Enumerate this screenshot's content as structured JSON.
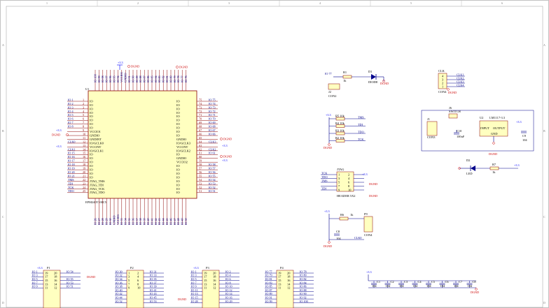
{
  "frame": {
    "columns": [
      "1",
      "2",
      "3",
      "4",
      "5",
      "6"
    ],
    "rows": [
      "A",
      "B",
      "C",
      "D"
    ]
  },
  "power": {
    "v33": "+3.3",
    "dgnd": "DGND"
  },
  "mcu": {
    "ref": "U1",
    "part": "EPM240T100C5",
    "left_pins": [
      {
        "net": "IO 1",
        "name": "IO",
        "num": "1"
      },
      {
        "net": "IO 2",
        "name": "IO",
        "num": "2"
      },
      {
        "net": "IO 3",
        "name": "IO",
        "num": "3"
      },
      {
        "net": "IO 4",
        "name": "IO",
        "num": "4"
      },
      {
        "net": "IO 5",
        "name": "IO",
        "num": "5"
      },
      {
        "net": "IO 6",
        "name": "IO",
        "num": "6"
      },
      {
        "net": "IO 7",
        "name": "IO",
        "num": "7"
      },
      {
        "net": "IO 8",
        "name": "IO",
        "num": "8"
      },
      {
        "net": "",
        "name": "VCCIO1",
        "num": "9"
      },
      {
        "net": "",
        "name": "GNDIO",
        "num": "10"
      },
      {
        "net": "",
        "name": "GNDINT",
        "num": "11"
      },
      {
        "net": "CLK0",
        "name": "IO/GCLK0",
        "num": "12"
      },
      {
        "net": "",
        "name": "VCCINT",
        "num": "13"
      },
      {
        "net": "CLK1",
        "name": "IO/GCLK1",
        "num": "14"
      },
      {
        "net": "IO 15",
        "name": "IO",
        "num": "15"
      },
      {
        "net": "IO 16",
        "name": "IO",
        "num": "16"
      },
      {
        "net": "IO 17",
        "name": "IO",
        "num": "17"
      },
      {
        "net": "IO 18",
        "name": "IO",
        "num": "18"
      },
      {
        "net": "IO 19",
        "name": "IO",
        "num": "19"
      },
      {
        "net": "IO 20",
        "name": "IO",
        "num": "20"
      },
      {
        "net": "IO 21",
        "name": "IO",
        "num": "21"
      },
      {
        "net": "TMS",
        "name": "JTAG_TMS",
        "num": "22"
      },
      {
        "net": "TDI",
        "name": "JTAG_TDI",
        "num": "23"
      },
      {
        "net": "TCK",
        "name": "JTAG_TCK",
        "num": "24"
      },
      {
        "net": "TDO",
        "name": "JTAG_TDO",
        "num": "25"
      }
    ],
    "right_pins": [
      {
        "net": "IO 75",
        "name": "IO",
        "num": "75"
      },
      {
        "net": "IO 74",
        "name": "IO",
        "num": "74"
      },
      {
        "net": "IO 73",
        "name": "IO",
        "num": "73"
      },
      {
        "net": "IO 72",
        "name": "IO",
        "num": "72"
      },
      {
        "net": "IO 71",
        "name": "IO",
        "num": "71"
      },
      {
        "net": "IO 70",
        "name": "IO",
        "num": "70"
      },
      {
        "net": "IO 69",
        "name": "IO",
        "num": "69"
      },
      {
        "net": "IO 68",
        "name": "IO",
        "num": "68"
      },
      {
        "net": "IO 67",
        "name": "IO",
        "num": "67"
      },
      {
        "net": "IO 66",
        "name": "IO",
        "num": "66"
      },
      {
        "net": "",
        "name": "GNDIO",
        "num": "65"
      },
      {
        "net": "CLK3",
        "name": "IO/GCLK3",
        "num": "64"
      },
      {
        "net": "",
        "name": "VCCINT",
        "num": "63"
      },
      {
        "net": "CLK2",
        "name": "IO/GCLK2",
        "num": "62"
      },
      {
        "net": "IO 61",
        "name": "IO",
        "num": "61"
      },
      {
        "net": "",
        "name": "GNDIO",
        "num": "60"
      },
      {
        "net": "",
        "name": "VCCIO2",
        "num": "59"
      },
      {
        "net": "IO 58",
        "name": "IO",
        "num": "58"
      },
      {
        "net": "IO 57",
        "name": "IO",
        "num": "57"
      },
      {
        "net": "IO 56",
        "name": "IO",
        "num": "56"
      },
      {
        "net": "IO 55",
        "name": "IO",
        "num": "55"
      },
      {
        "net": "IO 54",
        "name": "IO",
        "num": "54"
      },
      {
        "net": "IO 53",
        "name": "IO",
        "num": "53"
      },
      {
        "net": "IO 52",
        "name": "IO",
        "num": "52"
      },
      {
        "net": "IO 51",
        "name": "IO",
        "num": "51"
      }
    ],
    "top_pins": [
      "IO 100",
      "IO 99",
      "IO 98",
      "IO 97",
      "IO 96",
      "IO 95",
      "IO 94",
      "VCCIO1",
      "GNDIO",
      "IO 91",
      "IO 90",
      "IO 89",
      "IO 88",
      "IO 87",
      "IO 86",
      "IO 85",
      "IO 84",
      "IO 83",
      "IO 82",
      "IO 81",
      "IO 80",
      "IO 79",
      "IO 78",
      "IO 77",
      "IO 76"
    ],
    "bottom_pins": [
      "IO 26",
      "IO 27",
      "IO 28",
      "IO 29",
      "IO 30",
      "GNDIO",
      "VCCIO1",
      "IO 33",
      "IO 34",
      "IO 35",
      "IO 36",
      "IO 37",
      "IO 38",
      "IO 39",
      "IO 40",
      "IO 41",
      "IO 42",
      "IO 43",
      "IO 44",
      "IO 45",
      "IO 46",
      "IO 47",
      "IO 48",
      "IO 49",
      "IO 50"
    ]
  },
  "led_circuit": {
    "net": "IO 77",
    "r_ref": "R1",
    "r_val": "1k",
    "d_ref": "D1",
    "d_val": "DIODE",
    "j_ref": "J2",
    "j_val": "CON2"
  },
  "clock": {
    "ref": "CLK",
    "part": "CON4",
    "pins": [
      "4",
      "3",
      "2",
      "1"
    ],
    "nets": [
      "CLK1",
      "CLK2",
      "CLK3",
      "CLK4"
    ]
  },
  "pullups": {
    "resistors": [
      "R5 10k",
      "R4 10k",
      "R3 10k",
      "R2 10k"
    ],
    "nets": [
      "TMS",
      "TDI",
      "TDO",
      "TCK"
    ]
  },
  "regulator": {
    "switch_ref": "J6",
    "switch_val": "SWITCH",
    "jack_ref": "J1",
    "jack_val": "CON3",
    "cin_ref": "C10",
    "cin_val": "100uF",
    "ic_ref": "U2",
    "ic_val": "LM1117-3.3",
    "ic_in": "INPUT",
    "ic_out": "OUTPUT",
    "ic_gnd": "GND",
    "cout_ref": "C9",
    "cout_val": "104"
  },
  "power_led": {
    "d_ref": "D2",
    "d_val": "LED",
    "r_ref": "R7",
    "r_val": "1k"
  },
  "jtag": {
    "ref": "JTAG",
    "part": "HEADER 5X2",
    "left_nets": [
      "TCK",
      "TDO",
      "TMS",
      "",
      "TDI"
    ],
    "left_nums": [
      "1",
      "3",
      "5",
      "7",
      "9"
    ],
    "right_nums": [
      "2",
      "4",
      "6",
      "8",
      "10"
    ]
  },
  "p9": {
    "ref": "P9",
    "part": "CON4",
    "r_ref": "R6",
    "r_val": "1k",
    "c_ref": "C8",
    "c_val": "104",
    "net": "CLK0"
  },
  "bottom_headers": [
    {
      "ref": "P1",
      "left": [
        "IO 1",
        "IO 3",
        "IO 5",
        "IO 7",
        "IO 9"
      ],
      "right": [
        "IO 54",
        "",
        "IO 55",
        "IO 53",
        "IO 51"
      ],
      "nums_l": [
        "19",
        "17",
        "15",
        "13",
        "11"
      ],
      "nums_r": [
        "20",
        "18",
        "16",
        "14",
        "12"
      ]
    },
    {
      "ref": "P2",
      "left": [
        "IO 30",
        "IO 32",
        "IO 34",
        "IO 36",
        "IO 38",
        "IO 40",
        "IO 42",
        "IO 44",
        "IO 52"
      ],
      "right": [
        "IO 31",
        "IO 33",
        "IO 35",
        "IO 37",
        "IO 39",
        "IO 41",
        "IO 43",
        "IO 45",
        "IO 53"
      ],
      "nums_l": [
        "1",
        "3",
        "5",
        "7",
        "9"
      ],
      "nums_r": [
        "2",
        "4",
        "6",
        "8",
        "10"
      ]
    },
    {
      "ref": "P3",
      "left": [
        "IO 1",
        "IO 3",
        "IO 5",
        "IO 7",
        "IO 9",
        "IO 11",
        "IO 13",
        "IO 15",
        "IO 28"
      ],
      "right": [
        "IO 2",
        "IO 4",
        "IO 6",
        "IO 8",
        "IO 10",
        "IO 12",
        "IO 14",
        "IO 16",
        "IO 29"
      ],
      "nums_l": [
        "19",
        "17",
        "15",
        "13",
        "11"
      ],
      "nums_r": [
        "20",
        "18",
        "16",
        "14",
        "12"
      ]
    },
    {
      "ref": "P4",
      "left": [
        "IO 77",
        "IO 79",
        "IO 81",
        "IO 83",
        "IO 85",
        "IO 87",
        "IO 89",
        "IO 91",
        "IO 99"
      ],
      "right": [
        "IO 78",
        "IO 80",
        "IO 82",
        "IO 84",
        "IO 86",
        "IO 88",
        "IO 90",
        "IO 92",
        "IO 100"
      ],
      "nums_l": [
        "19",
        "17",
        "15",
        "13",
        "11"
      ],
      "nums_r": [
        "20",
        "18",
        "16",
        "14",
        "12"
      ]
    }
  ],
  "decoupling": {
    "refs": [
      "C1",
      "C2",
      "C3",
      "C4",
      "C5",
      "C6",
      "C7",
      "C8"
    ],
    "value": "104"
  }
}
